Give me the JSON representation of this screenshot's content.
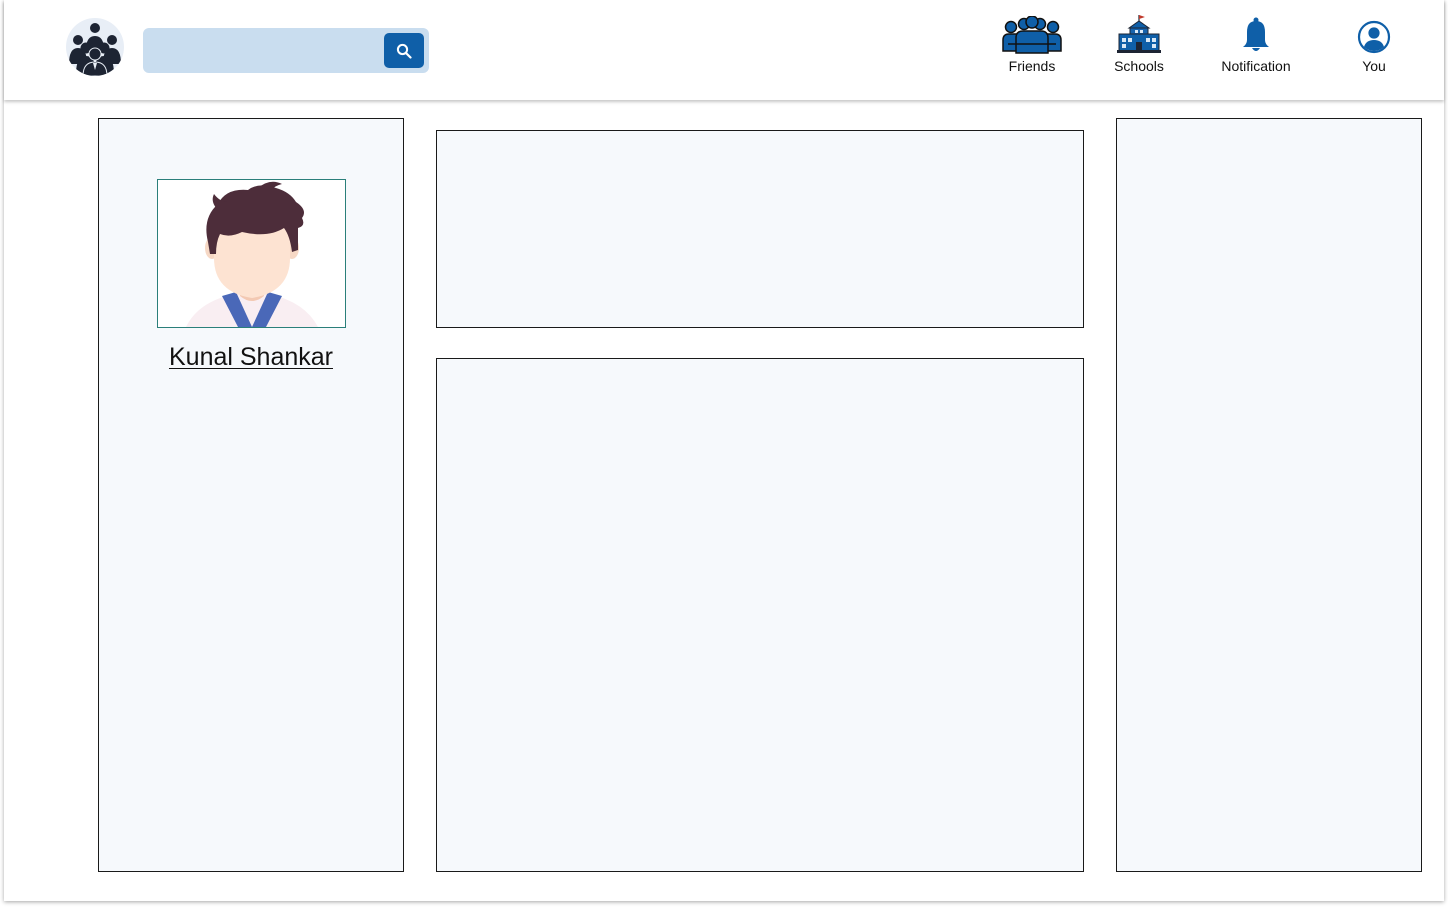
{
  "header": {
    "logo_icon": "community-group-icon",
    "search": {
      "placeholder": "",
      "value": "",
      "button_icon": "search-icon"
    },
    "nav": [
      {
        "label": "Friends",
        "icon": "friends-icon"
      },
      {
        "label": "Schools",
        "icon": "school-building-icon"
      },
      {
        "label": "Notification",
        "icon": "bell-icon"
      },
      {
        "label": "You",
        "icon": "user-circle-icon"
      }
    ]
  },
  "profile": {
    "name": "Kunal Shankar",
    "avatar_icon": "user-avatar"
  },
  "colors": {
    "accent": "#0f5fa8",
    "search_bg": "#c9ddef",
    "panel_bg": "#f6f9fc",
    "avatar_border": "#2a7f7a"
  }
}
